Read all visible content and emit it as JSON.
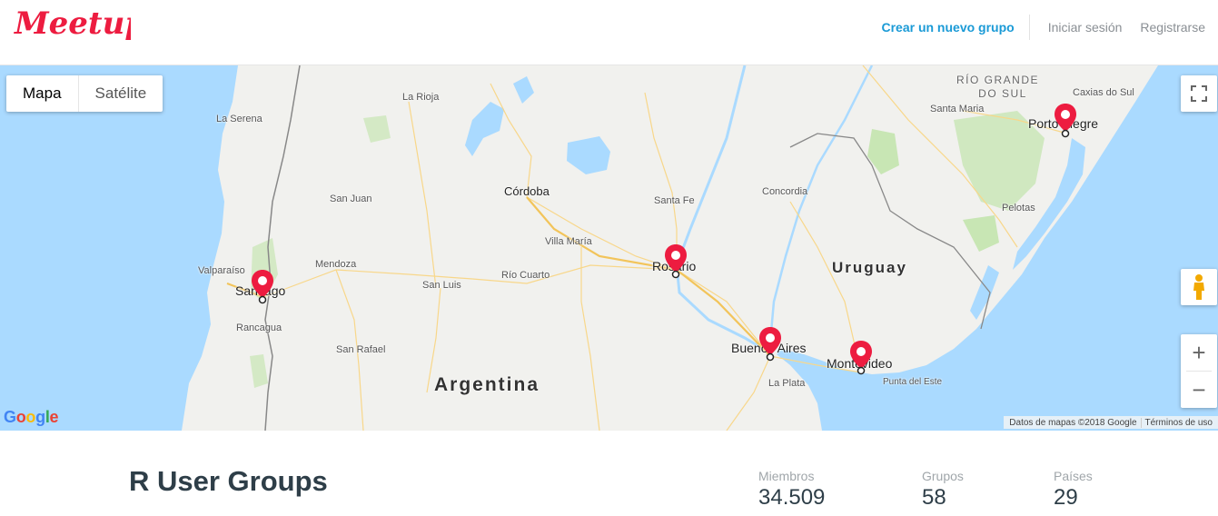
{
  "header": {
    "logo_text": "Meetup",
    "create_group": "Crear un nuevo grupo",
    "login": "Iniciar sesión",
    "register": "Registrarse"
  },
  "map": {
    "type_map": "Mapa",
    "type_satellite": "Satélite",
    "google": "Google",
    "data_credit": "Datos de mapas ©2018 Google",
    "terms": "Términos de uso",
    "labels": {
      "la_rioja": "La Rioja",
      "la_serena": "La Serena",
      "rio_grande_1": "RÍO GRANDE",
      "rio_grande_2": "DO SUL",
      "caxias": "Caxias do Sul",
      "santa_maria": "Santa Maria",
      "porto_alegre": "Porto Alegre",
      "cordoba": "Córdoba",
      "san_juan": "San Juan",
      "santa_fe": "Santa Fe",
      "concordia": "Concordia",
      "pelotas": "Pelotas",
      "villa_maria": "Villa María",
      "rosario": "Rosario",
      "valparaiso": "Valparaíso",
      "mendoza": "Mendoza",
      "santiago": "Santiago",
      "uruguay": "Uruguay",
      "rio_cuarto": "Río Cuarto",
      "san_luis": "San Luis",
      "rancagua": "Rancagua",
      "buenos_aires": "Buenos Aires",
      "montevideo": "Montevideo",
      "san_rafael": "San Rafael",
      "la_plata": "La Plata",
      "punta_del_este": "Punta del Este",
      "argentina": "Argentina"
    }
  },
  "summary": {
    "title": "R User Groups",
    "members_label": "Miembros",
    "members_value": "34.509",
    "groups_label": "Grupos",
    "groups_value": "58",
    "countries_label": "Países",
    "countries_value": "29"
  },
  "colors": {
    "brand": "#ed1c40",
    "link": "#1a9ad6",
    "water": "#aadaff",
    "land": "#f1f1ee",
    "park": "#c8e6b4"
  }
}
